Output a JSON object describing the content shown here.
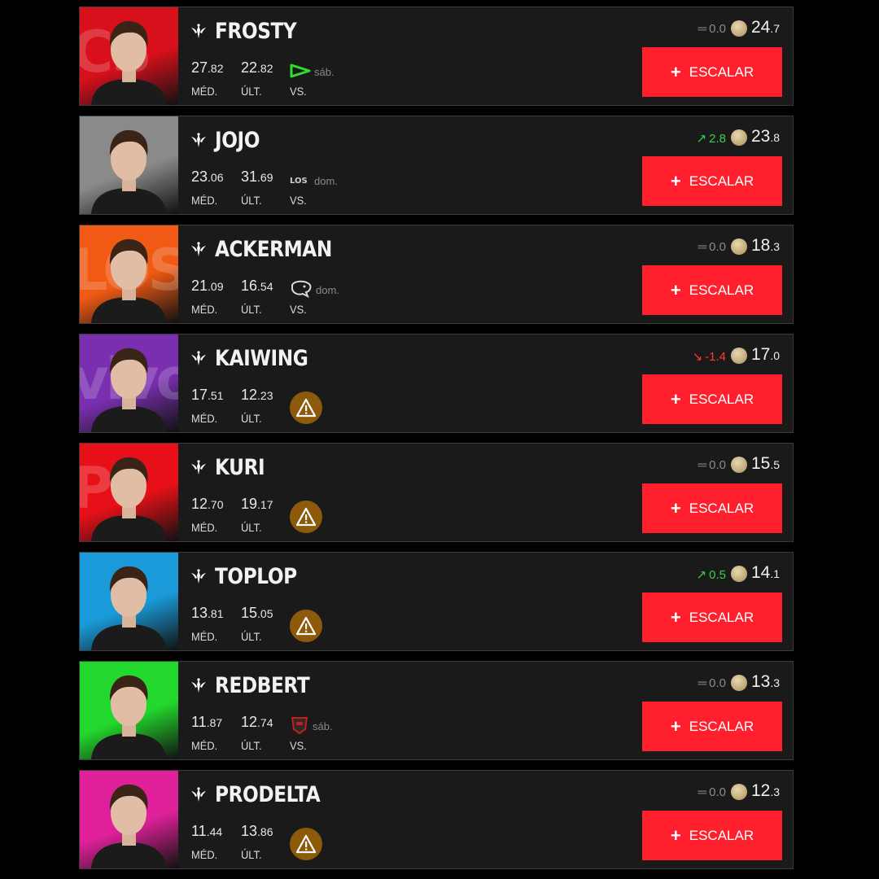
{
  "labels": {
    "avg": "MÉD.",
    "last": "ÚLT.",
    "vs": "VS.",
    "button": "ESCALAR"
  },
  "colors": {
    "accent": "#ff1f2d",
    "up": "#37d04a",
    "down": "#ff3b30"
  },
  "players": [
    {
      "name": "FROSTY",
      "avg_int": "27",
      "avg_dec": ".82",
      "last_int": "22",
      "last_dec": ".82",
      "opponent_day": "sáb.",
      "opponent_logo": "green-arrow-logo",
      "warning": false,
      "trend": "flat",
      "change": "0.0",
      "price_int": "24",
      "price_dec": ".7",
      "photo_color": "#d8101c",
      "team_mark": "CS"
    },
    {
      "name": "JOJO",
      "avg_int": "23",
      "avg_dec": ".06",
      "last_int": "31",
      "last_dec": ".69",
      "opponent_day": "dom.",
      "opponent_logo": "los-logo",
      "warning": false,
      "trend": "up",
      "change": "2.8",
      "price_int": "23",
      "price_dec": ".8",
      "photo_color": "#8a8a8a",
      "team_mark": ""
    },
    {
      "name": "ACKERMAN",
      "avg_int": "21",
      "avg_dec": ".09",
      "last_int": "16",
      "last_dec": ".54",
      "opponent_day": "dom.",
      "opponent_logo": "panther-logo",
      "warning": false,
      "trend": "flat",
      "change": "0.0",
      "price_int": "18",
      "price_dec": ".3",
      "photo_color": "#f05a14",
      "team_mark": "LOS"
    },
    {
      "name": "KAIWING",
      "avg_int": "17",
      "avg_dec": ".51",
      "last_int": "12",
      "last_dec": ".23",
      "opponent_day": "",
      "opponent_logo": "",
      "warning": true,
      "trend": "down",
      "change": "-1.4",
      "price_int": "17",
      "price_dec": ".0",
      "photo_color": "#7a2fb0",
      "team_mark": "vivo"
    },
    {
      "name": "KURI",
      "avg_int": "12",
      "avg_dec": ".70",
      "last_int": "19",
      "last_dec": ".17",
      "opponent_day": "",
      "opponent_logo": "",
      "warning": true,
      "trend": "flat",
      "change": "0.0",
      "price_int": "15",
      "price_dec": ".5",
      "photo_color": "#e81018",
      "team_mark": "P"
    },
    {
      "name": "TOPLOP",
      "avg_int": "13",
      "avg_dec": ".81",
      "last_int": "15",
      "last_dec": ".05",
      "opponent_day": "",
      "opponent_logo": "",
      "warning": true,
      "trend": "up",
      "change": "0.5",
      "price_int": "14",
      "price_dec": ".1",
      "photo_color": "#1a9ad8",
      "team_mark": ""
    },
    {
      "name": "REDBERT",
      "avg_int": "11",
      "avg_dec": ".87",
      "last_int": "12",
      "last_dec": ".74",
      "opponent_day": "sáb.",
      "opponent_logo": "red-team-logo",
      "warning": false,
      "trend": "flat",
      "change": "0.0",
      "price_int": "13",
      "price_dec": ".3",
      "photo_color": "#22d82c",
      "team_mark": ""
    },
    {
      "name": "PRODELTA",
      "avg_int": "11",
      "avg_dec": ".44",
      "last_int": "13",
      "last_dec": ".86",
      "opponent_day": "",
      "opponent_logo": "",
      "warning": true,
      "trend": "flat",
      "change": "0.0",
      "price_int": "12",
      "price_dec": ".3",
      "photo_color": "#e0209a",
      "team_mark": ""
    }
  ]
}
